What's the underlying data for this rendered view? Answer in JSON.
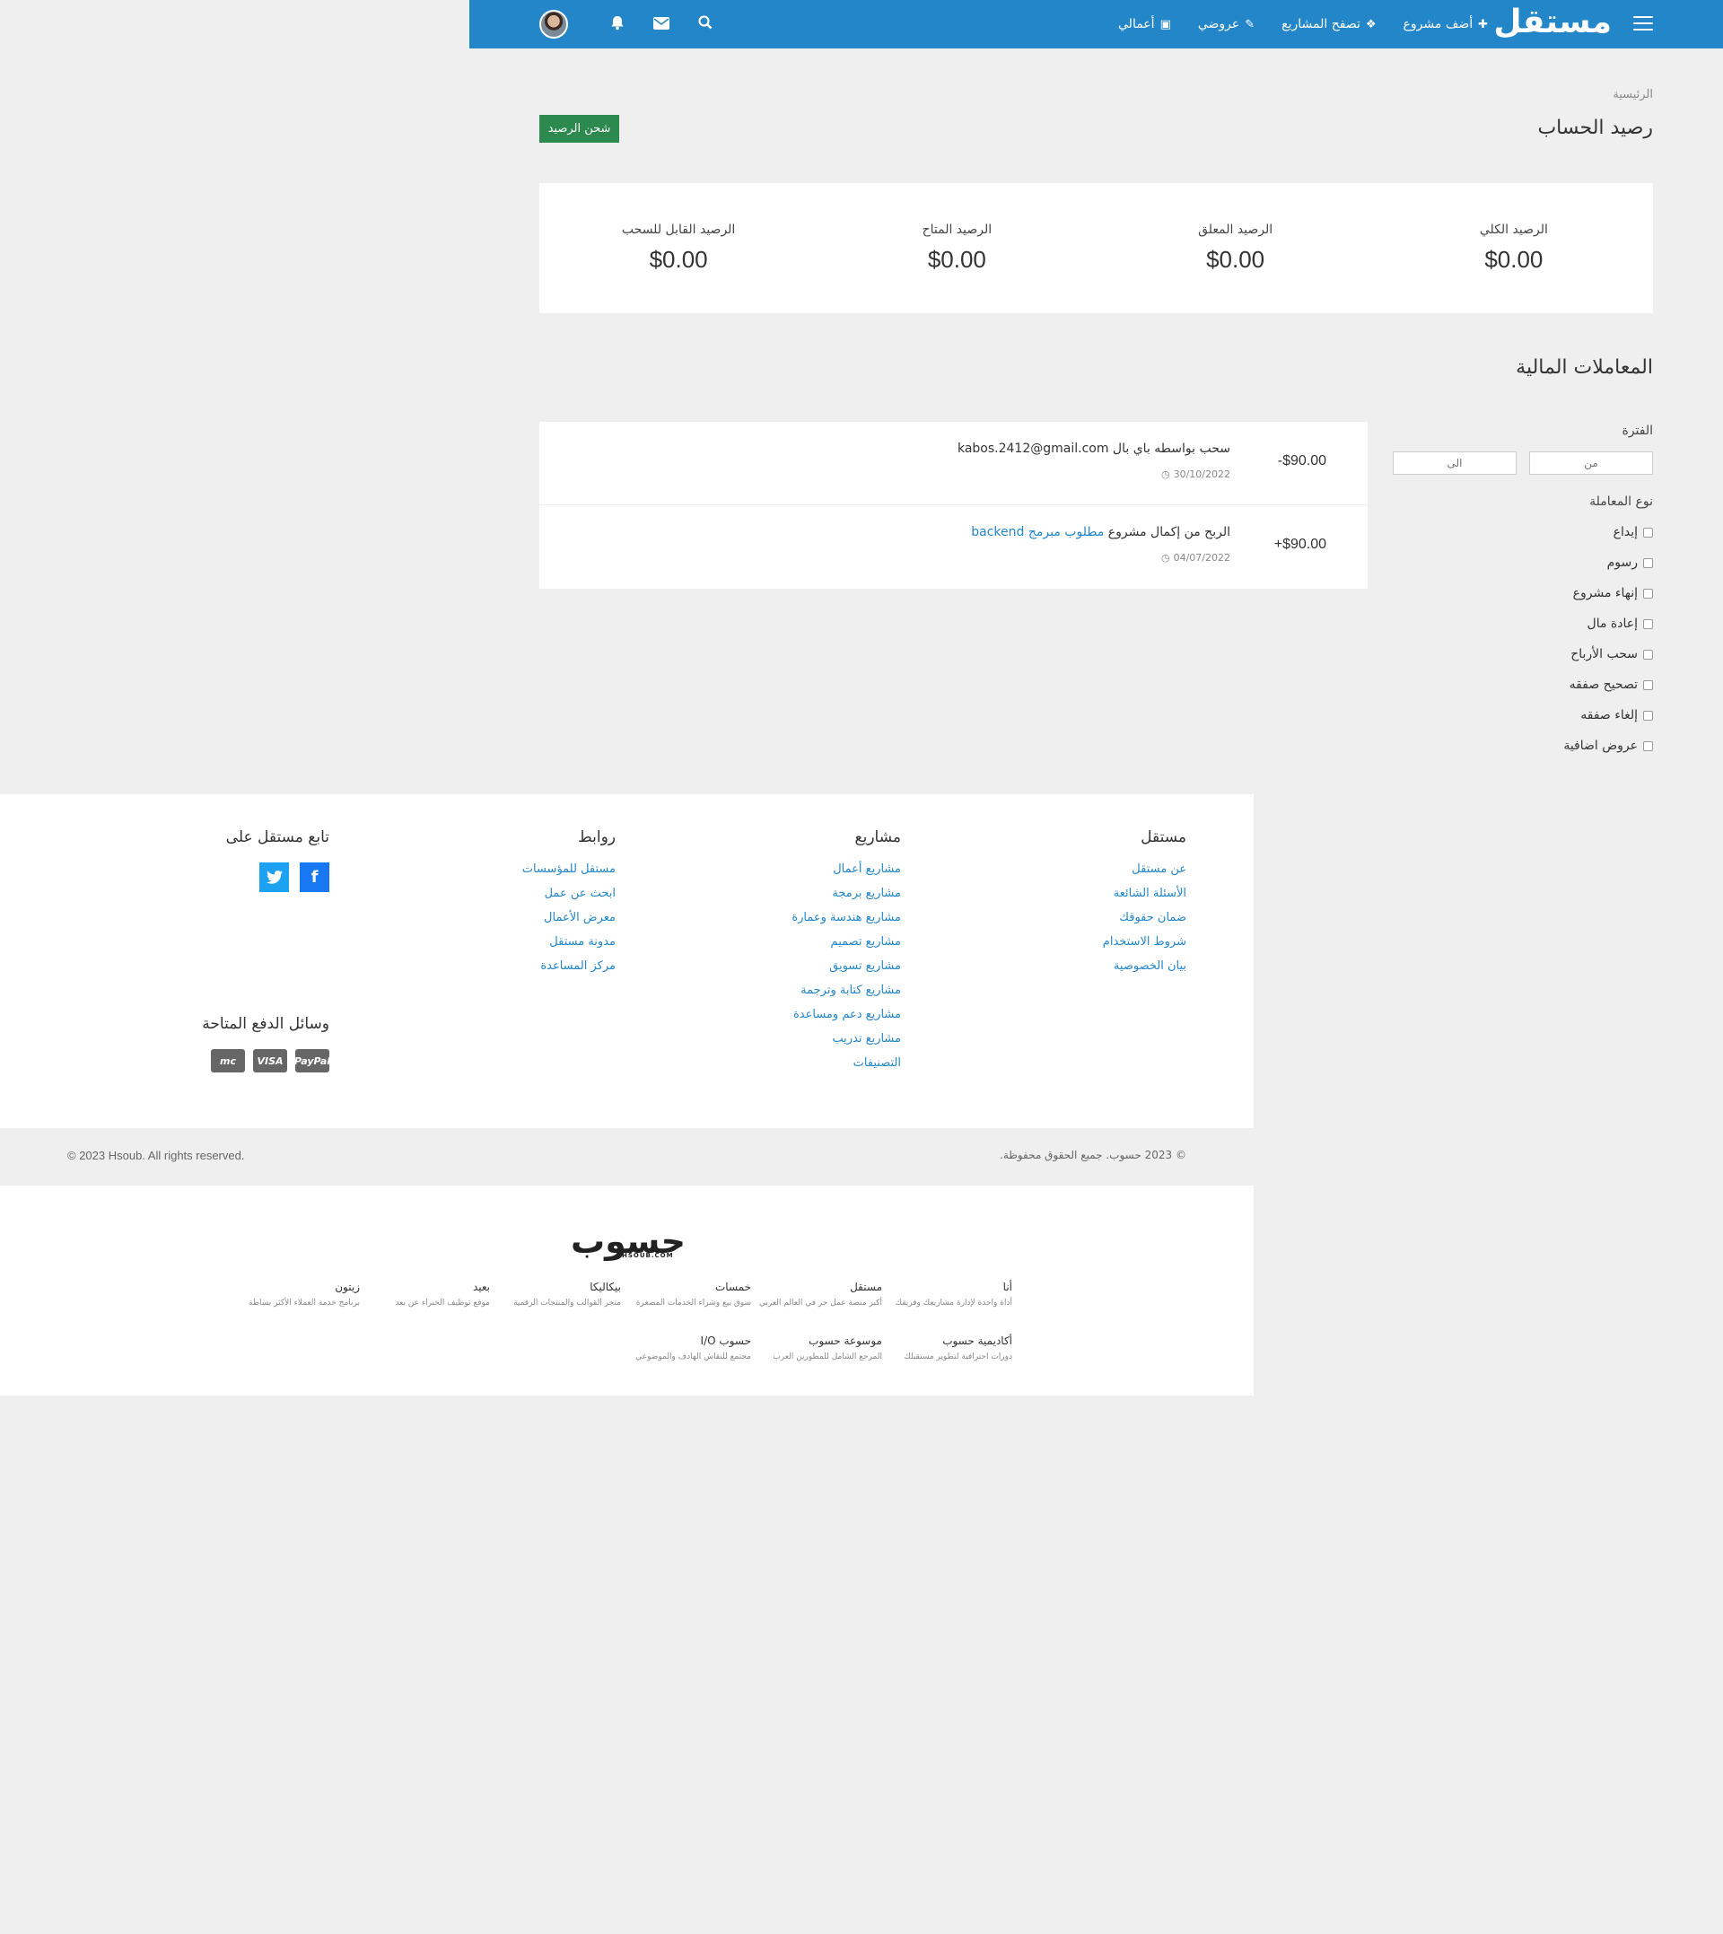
{
  "header": {
    "logo": "مستقل",
    "nav": [
      {
        "label": "أضف مشروع",
        "icon": "plus-icon",
        "glyph": "✚"
      },
      {
        "label": "تصفح المشاريع",
        "icon": "cubes-icon",
        "glyph": "❖"
      },
      {
        "label": "عروضي",
        "icon": "ticket-icon",
        "glyph": "✎"
      },
      {
        "label": "أعمالي",
        "icon": "briefcase-icon",
        "glyph": "▣"
      }
    ]
  },
  "breadcrumb": "الرئيسية",
  "page_title": "رصيد الحساب",
  "charge_button": "شحن الرصيد",
  "balances": [
    {
      "label": "الرصيد الكلي",
      "value": "$0.00"
    },
    {
      "label": "الرصيد المعلق",
      "value": "$0.00"
    },
    {
      "label": "الرصيد المتاح",
      "value": "$0.00"
    },
    {
      "label": "الرصيد القابل للسحب",
      "value": "$0.00"
    }
  ],
  "transactions_title": "المعاملات المالية",
  "filters": {
    "period_label": "الفترة",
    "from_placeholder": "من",
    "to_placeholder": "الى",
    "type_label": "نوع المعاملة",
    "types": [
      "إيداع",
      "رسوم",
      "إنهاء مشروع",
      "إعادة مال",
      "سحب الأرباح",
      "تصحيح صفقه",
      "إلغاء صفقه",
      "عروض اضافية"
    ]
  },
  "transactions": [
    {
      "amount": "-$90.00",
      "text": "سحب بواسطه باي بال kabos.2412@gmail.com",
      "link": "",
      "date": "30/10/2022"
    },
    {
      "amount": "+$90.00",
      "text": "الربح من إكمال مشروع",
      "link": "مطلوب مبرمج backend",
      "date": "04/07/2022"
    }
  ],
  "footer": {
    "col1": {
      "title": "مستقل",
      "links": [
        "عن مستقل",
        "الأسئلة الشائعة",
        "ضمان حقوقك",
        "شروط الاستخدام",
        "بيان الخصوصية"
      ]
    },
    "col2": {
      "title": "مشاريع",
      "links": [
        "مشاريع أعمال",
        "مشاريع برمجة",
        "مشاريع هندسة وعمارة",
        "مشاريع تصميم",
        "مشاريع تسويق",
        "مشاريع كتابة وترجمة",
        "مشاريع دعم ومساعدة",
        "مشاريع تدريب",
        "التصنيفات"
      ]
    },
    "col3": {
      "title": "روابط",
      "links": [
        "مستقل للمؤسسات",
        "ابحث عن عمل",
        "معرض الأعمال",
        "مدونة مستقل",
        "مركز المساعدة"
      ]
    },
    "follow_title": "تابع مستقل على",
    "payment_title": "وسائل الدفع المتاحة",
    "payments": [
      "PayPal",
      "VISA",
      "mc"
    ]
  },
  "copyright_ar": "© 2023 حسوب. جميع الحقوق محفوظة.",
  "copyright_en": "© 2023 Hsoub. All rights reserved.",
  "hsoub": {
    "logo": "حسوب",
    "sub": "HSOUB.COM",
    "products": [
      {
        "name": "أنا",
        "desc": "أداة واحدة لإدارة مشاريعك وفريقك"
      },
      {
        "name": "مستقل",
        "desc": "أكبر منصة عمل حر في العالم العربي"
      },
      {
        "name": "خمسات",
        "desc": "سوق بيع وشراء الخدمات المصغرة"
      },
      {
        "name": "بيكاليكا",
        "desc": "متجر القوالب والمنتجات الرقمية"
      },
      {
        "name": "بعيد",
        "desc": "موقع توظيف الخبراء عن بعد"
      },
      {
        "name": "زيتون",
        "desc": "برنامج خدمة العملاء الأكثر بساطة"
      },
      {
        "name": "أكاديمية حسوب",
        "desc": "دورات احترافية لتطوير مستقبلك"
      },
      {
        "name": "موسوعة حسوب",
        "desc": "المرجع الشامل للمطورين العرب"
      },
      {
        "name": "حسوب I/O",
        "desc": "مجتمع للنقاش الهادف والموضوعي"
      }
    ]
  }
}
